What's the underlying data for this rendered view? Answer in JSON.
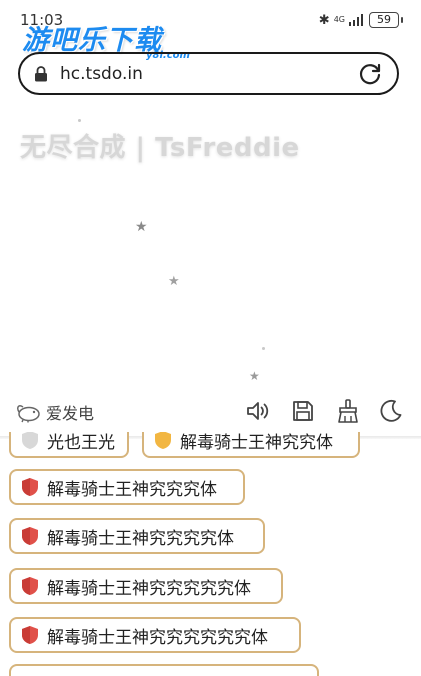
{
  "status": {
    "time": "11:03",
    "network": "4G",
    "battery": "59"
  },
  "watermark": {
    "title": "游吧乐下载",
    "sub": "y8l.com"
  },
  "address_bar": {
    "url": "hc.tsdo.in"
  },
  "page": {
    "title": "无尽合成 | TsFreddie"
  },
  "toolbar": {
    "brand_label": "爱发电",
    "icons": [
      "volume-icon",
      "save-icon",
      "clear-icon",
      "dark-mode-icon"
    ]
  },
  "items": [
    {
      "label": "解毒骑士王神究究究体"
    },
    {
      "label": "解毒骑士王神究究究究体"
    },
    {
      "label": "解毒骑士王神究究究究究体"
    },
    {
      "label": "解毒骑士王神究究究究究究体"
    }
  ],
  "partial_items": [
    {
      "label": "光也王光"
    },
    {
      "label": "解毒骑士王神究究体"
    }
  ],
  "colors": {
    "item_border": "#d6b47c",
    "shield": "#e0514a",
    "watermark": "#1d8bf0",
    "title": "#d7d7d7"
  }
}
